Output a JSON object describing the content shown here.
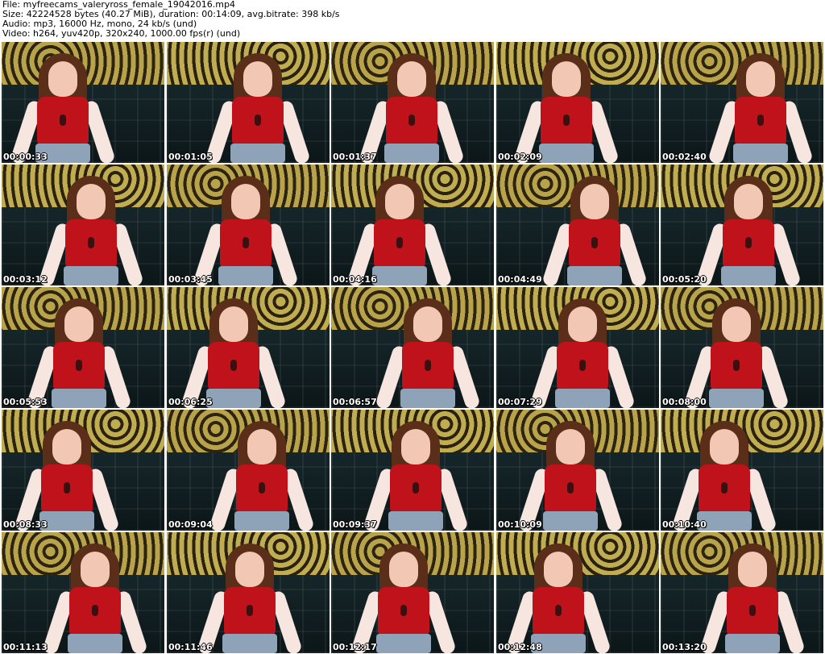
{
  "header": {
    "file": "File: myfreecams_valeryross_female_19042016.mp4",
    "size": "Size: 42224528 bytes (40.27 MiB), duration: 00:14:09, avg.bitrate: 398 kb/s",
    "audio": "Audio: mp3, 16000 Hz, mono, 24 kb/s (und)",
    "video": "Video: h264, yuv420p, 320x240, 1000.00 fps(r) (und)"
  },
  "thumbnails": [
    {
      "timestamp": "00:00:33"
    },
    {
      "timestamp": "00:01:05"
    },
    {
      "timestamp": "00:01:37"
    },
    {
      "timestamp": "00:02:09"
    },
    {
      "timestamp": "00:02:40"
    },
    {
      "timestamp": "00:03:12"
    },
    {
      "timestamp": "00:03:45"
    },
    {
      "timestamp": "00:04:16"
    },
    {
      "timestamp": "00:04:49"
    },
    {
      "timestamp": "00:05:20"
    },
    {
      "timestamp": "00:05:53"
    },
    {
      "timestamp": "00:06:25"
    },
    {
      "timestamp": "00:06:57"
    },
    {
      "timestamp": "00:07:29"
    },
    {
      "timestamp": "00:08:00"
    },
    {
      "timestamp": "00:08:33"
    },
    {
      "timestamp": "00:09:04"
    },
    {
      "timestamp": "00:09:37"
    },
    {
      "timestamp": "00:10:09"
    },
    {
      "timestamp": "00:10:40"
    },
    {
      "timestamp": "00:11:13"
    },
    {
      "timestamp": "00:11:46"
    },
    {
      "timestamp": "00:12:17"
    },
    {
      "timestamp": "00:12:48"
    },
    {
      "timestamp": "00:13:20"
    }
  ],
  "colors": {
    "top": "#c0121a",
    "couch": "#15262a",
    "wall": "#a89240",
    "timestamp_text": "#ffffff"
  }
}
